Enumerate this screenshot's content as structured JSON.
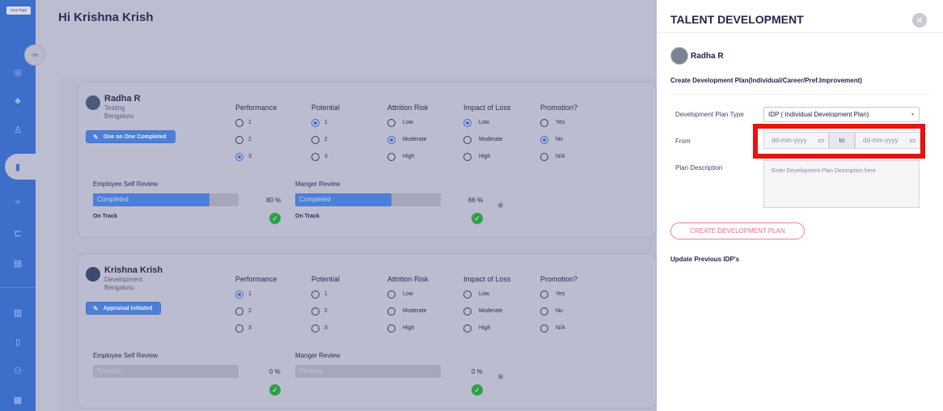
{
  "app": {
    "logo_text": "your logo"
  },
  "header": {
    "greeting": "Hi Krishna Krish"
  },
  "table_columns": [
    "Performance",
    "Potential",
    "Attrition Risk",
    "Impact of Loss",
    "Promotion?"
  ],
  "options": {
    "performance": [
      "1",
      "2",
      "3"
    ],
    "potential": [
      "1",
      "2",
      "3"
    ],
    "attrition": [
      "Low",
      "Moderate",
      "High"
    ],
    "impact": [
      "Low",
      "Moderate",
      "High"
    ],
    "promotion": [
      "Yes",
      "No",
      "N/A"
    ]
  },
  "review_labels": {
    "self": "Employee Self Review",
    "manager": "Manger Review"
  },
  "employees": [
    {
      "name": "Radha R",
      "role": "Testing",
      "city": "Bengaluru",
      "status": "One on One Completed",
      "selected": {
        "performance": "3",
        "potential": "1",
        "attrition": "Moderate",
        "impact": "Low",
        "promotion": "No"
      },
      "self_review": {
        "label": "Completed",
        "percent_text": "80 %",
        "progress": 0.8,
        "track": "On Track"
      },
      "manager_review": {
        "label": "Completed",
        "percent_text": "66 %",
        "progress": 0.66,
        "track": "On Track"
      }
    },
    {
      "name": "Krishna Krish",
      "role": "Development",
      "city": "Bengaluru",
      "status": "Appraisal Initiated",
      "selected": {
        "performance": "1",
        "potential": "",
        "attrition": "",
        "impact": "",
        "promotion": ""
      },
      "self_review": {
        "label": "Pending",
        "percent_text": "0 %",
        "progress": 0,
        "track": ""
      },
      "manager_review": {
        "label": "Pending",
        "percent_text": "0 %",
        "progress": 0,
        "track": ""
      }
    }
  ],
  "drawer": {
    "title": "TALENT DEVELOPMENT",
    "employee_name": "Radha R",
    "subtitle": "Create Development Plan(Individual/Career/Pref.Improvement)",
    "plan_type_label": "Development Plan Type",
    "plan_type_value": "IDP ( Individual Development Plan)",
    "from_label": "From",
    "from_placeholder": "dd-mm-yyyy",
    "to_label": "to",
    "to_placeholder": "dd-mm-yyyy",
    "description_label": "Plan Description",
    "description_placeholder": "Enter Development Plan Description here",
    "create_button": "CREATE DEVELOPMENT PLAN",
    "update_link": "Update Previous IDP's"
  },
  "icons": {
    "sidebar": [
      "target-icon",
      "team-icon",
      "person-icon",
      "book-icon",
      "handshake-icon",
      "hierarchy-icon",
      "document-icon",
      "chart-icon",
      "book-icon",
      "group-icon",
      "report-icon"
    ]
  }
}
